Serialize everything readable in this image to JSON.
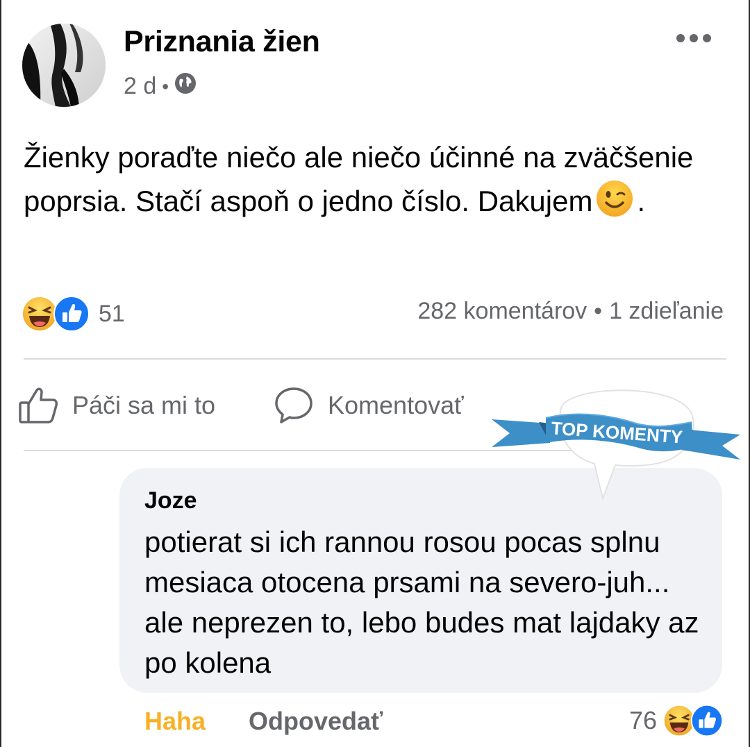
{
  "post": {
    "page_name": "Priznania žien",
    "time": "2 d",
    "meta_separator": "•",
    "privacy_icon": "globe-icon",
    "text": "Žienky poraďte niečo ale niečo účinné na zväčšenie poprsia. Stačí aspoň o jedno číslo. Dakujem",
    "text_end": ".",
    "inline_emoji": "winking-face-icon"
  },
  "reactions": {
    "icons": [
      "laughing-face-icon",
      "like-icon"
    ],
    "count": "51",
    "comments": "282 komentárov",
    "separator": "•",
    "shares": "1 zdieľanie"
  },
  "actions": {
    "like_label": "Páči sa mi to",
    "comment_label": "Komentovať"
  },
  "badge": {
    "label": "TOP KOMENTY",
    "color": "#3d8fc8"
  },
  "comment": {
    "author": "Joze",
    "text": "potierat si ich rannou rosou pocas splnu mesiaca otocena prsami na severo-juh... ale neprezen to, lebo budes mat lajdaky az po kolena",
    "haha_label": "Haha",
    "reply_label": "Odpovedať",
    "reaction_count": "76",
    "reaction_icons": [
      "laughing-face-icon",
      "like-icon"
    ]
  },
  "colors": {
    "text_primary": "#050505",
    "text_secondary": "#65676b",
    "haha": "#f7b125",
    "like_blue": "#1877f2",
    "bubble": "#f0f2f5"
  }
}
